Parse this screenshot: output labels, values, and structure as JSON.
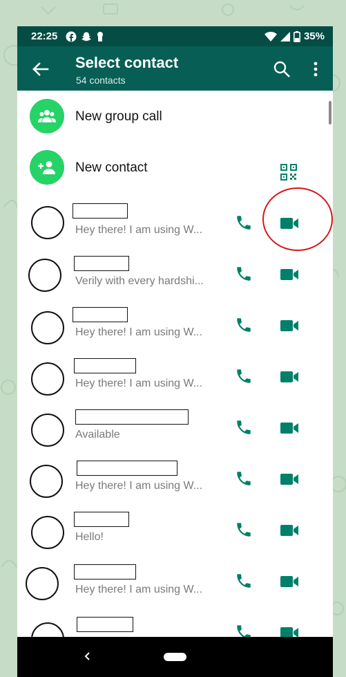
{
  "status_bar": {
    "time": "22:25",
    "battery": "35%",
    "left_icons": [
      "facebook-icon",
      "snapchat-icon",
      "keyhole-icon"
    ],
    "right_icons": [
      "wifi-icon",
      "signal-icon",
      "battery-icon"
    ]
  },
  "app_bar": {
    "title": "Select contact",
    "subtitle": "54 contacts",
    "back_icon": "arrow-left-icon",
    "search_icon": "search-icon",
    "menu_icon": "more-vert-icon"
  },
  "actions": {
    "new_group_call": "New group call",
    "new_contact": "New contact"
  },
  "contacts": [
    {
      "status": "Hey there! I am using W..."
    },
    {
      "status": "Verily with every hardshi..."
    },
    {
      "status": "Hey there! I am using W..."
    },
    {
      "status": "Hey there! I am using W..."
    },
    {
      "status": "Available"
    },
    {
      "status": "Hey there! I am using W..."
    },
    {
      "status": "Hello!"
    },
    {
      "status": "Hey there! I am using W..."
    },
    {
      "status": ""
    }
  ],
  "colors": {
    "header": "#075e54",
    "status_bar": "#054d44",
    "accent": "#25d366",
    "icon_teal": "#008069",
    "highlight": "#d81515"
  }
}
